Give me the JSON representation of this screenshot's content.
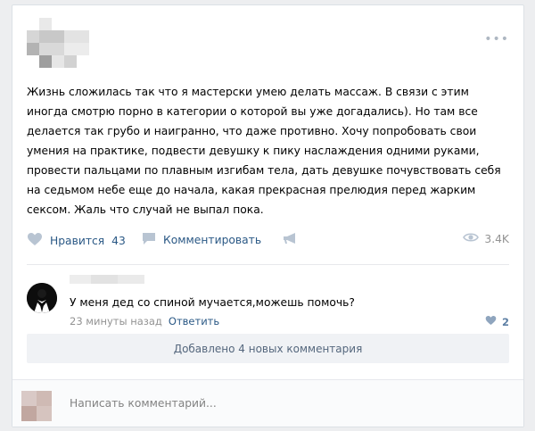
{
  "post": {
    "text": "Жизнь сложилась так что я мастерски умею делать массаж. В связи с этим иногда смотрю порно в категории о которой вы уже догадались). Но там все делается так грубо и наигранно, что даже противно. Хочу попробовать свои умения на практике, подвести девушку к пику наслаждения одними руками, провести пальцами по плавным изгибам тела, дать девушке почувствовать себя на седьмом небе еще до начала, какая прекрасная прелюдия перед жарким сексом. Жаль что случай не выпал пока.",
    "more_icon": "ellipsis-icon"
  },
  "actions": {
    "like_label": "Нравится",
    "like_count": "43",
    "comment_label": "Комментировать",
    "share_icon": "megaphone-icon",
    "views": "3.4K"
  },
  "comment": {
    "text": "У меня дед со спиной мучается,можешь помочь?",
    "time": "23 минуты назад",
    "reply_label": "Ответить",
    "likes": "2"
  },
  "more_comments_label": "Добавлено 4 новых комментария",
  "composer": {
    "placeholder": "Написать комментарий..."
  },
  "colors": {
    "link": "#2a5885",
    "muted": "#939393",
    "icon": "#aeb7c2",
    "background": "#edeef0"
  }
}
